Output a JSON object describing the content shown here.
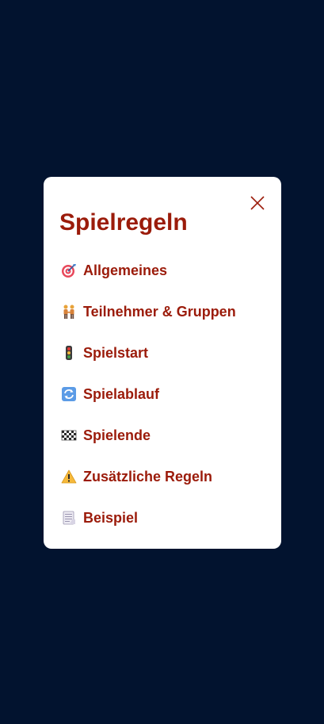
{
  "modal": {
    "title": "Spielregeln",
    "close_icon": "close-icon",
    "accent_color": "#9B1B0A",
    "backdrop_color": "#02132F"
  },
  "menu": {
    "items": [
      {
        "icon": "target-icon",
        "label": "Allgemeines"
      },
      {
        "icon": "people-holding-hands-icon",
        "label": "Teilnehmer & Gruppen"
      },
      {
        "icon": "traffic-light-icon",
        "label": "Spielstart"
      },
      {
        "icon": "refresh-icon",
        "label": "Spielablauf"
      },
      {
        "icon": "checkered-flag-icon",
        "label": "Spielende"
      },
      {
        "icon": "warning-icon",
        "label": "Zusätzliche Regeln"
      },
      {
        "icon": "document-icon",
        "label": "Beispiel"
      }
    ]
  }
}
